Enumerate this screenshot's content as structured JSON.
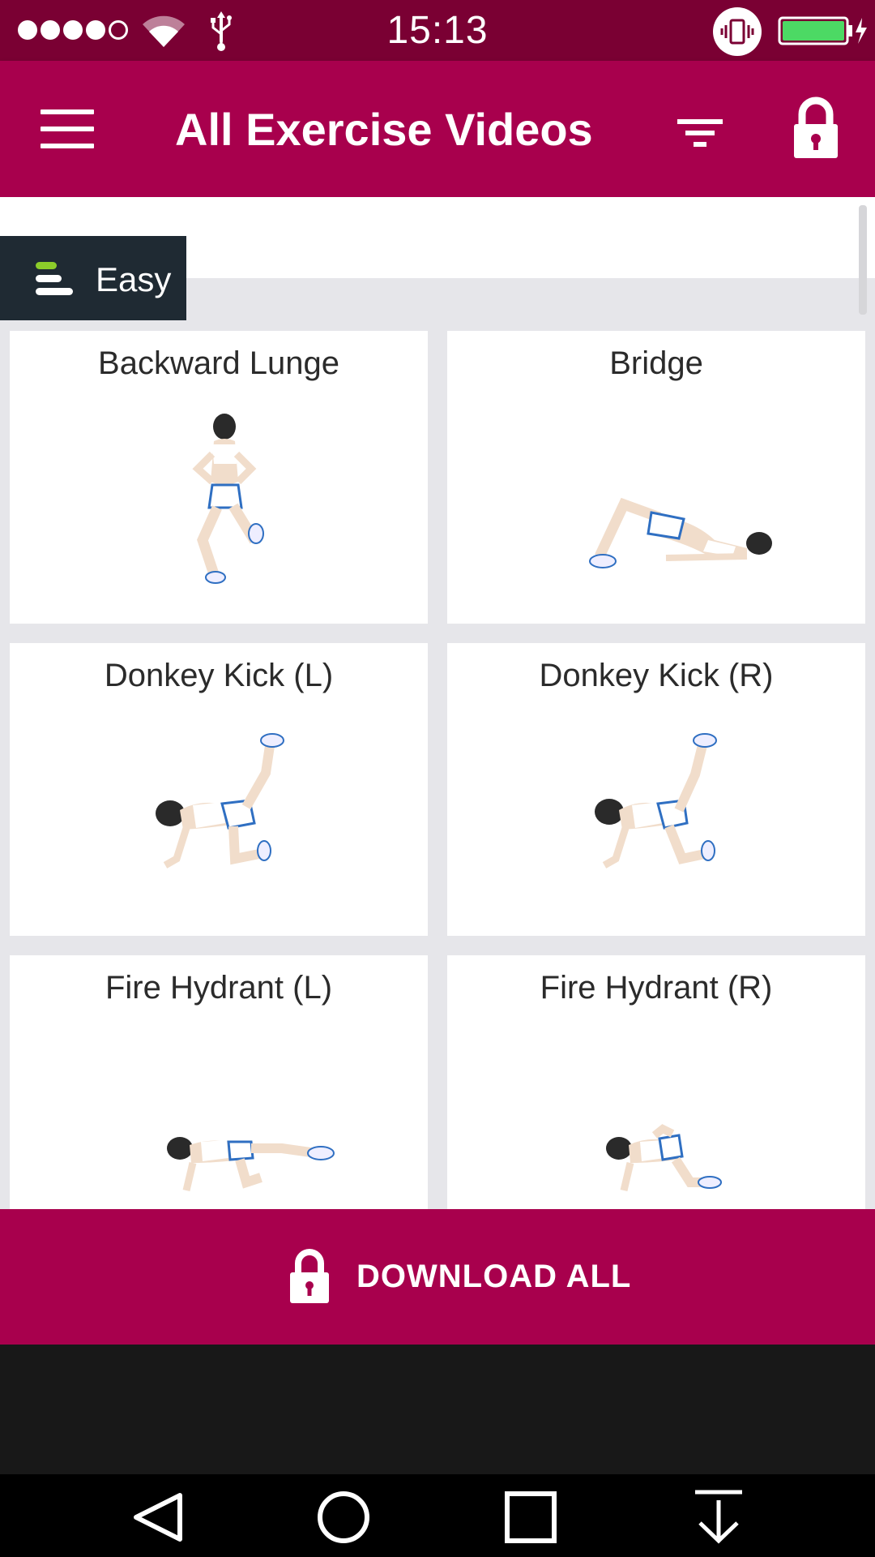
{
  "status_bar": {
    "time": "15:13",
    "signal_icon": "signal-dots-icon",
    "wifi_icon": "wifi-icon",
    "usb_icon": "usb-icon",
    "vibrate_icon": "vibrate-icon",
    "battery_icon": "battery-charging-icon",
    "battery_color": "#4cd964"
  },
  "app_bar": {
    "title": "All Exercise Videos",
    "menu_icon": "hamburger-menu-icon",
    "filter_icon": "filter-icon",
    "lock_icon": "lock-icon"
  },
  "level_filter": {
    "label": "Easy",
    "icon": "difficulty-level-icon",
    "accent_color": "#8ccc2a"
  },
  "exercises": [
    {
      "name": "Backward Lunge"
    },
    {
      "name": "Bridge"
    },
    {
      "name": "Donkey Kick (L)"
    },
    {
      "name": "Donkey Kick (R)"
    },
    {
      "name": "Fire Hydrant (L)"
    },
    {
      "name": "Fire Hydrant (R)"
    }
  ],
  "download": {
    "label": "DOWNLOAD ALL",
    "icon": "lock-icon"
  },
  "nav_bar": {
    "back_icon": "back-triangle-icon",
    "home_icon": "home-circle-icon",
    "recents_icon": "recents-square-icon",
    "download_icon": "download-arrow-icon"
  },
  "colors": {
    "primary": "#a8004d",
    "status_bar": "#7a0033",
    "chip_background": "#1f2a33"
  }
}
